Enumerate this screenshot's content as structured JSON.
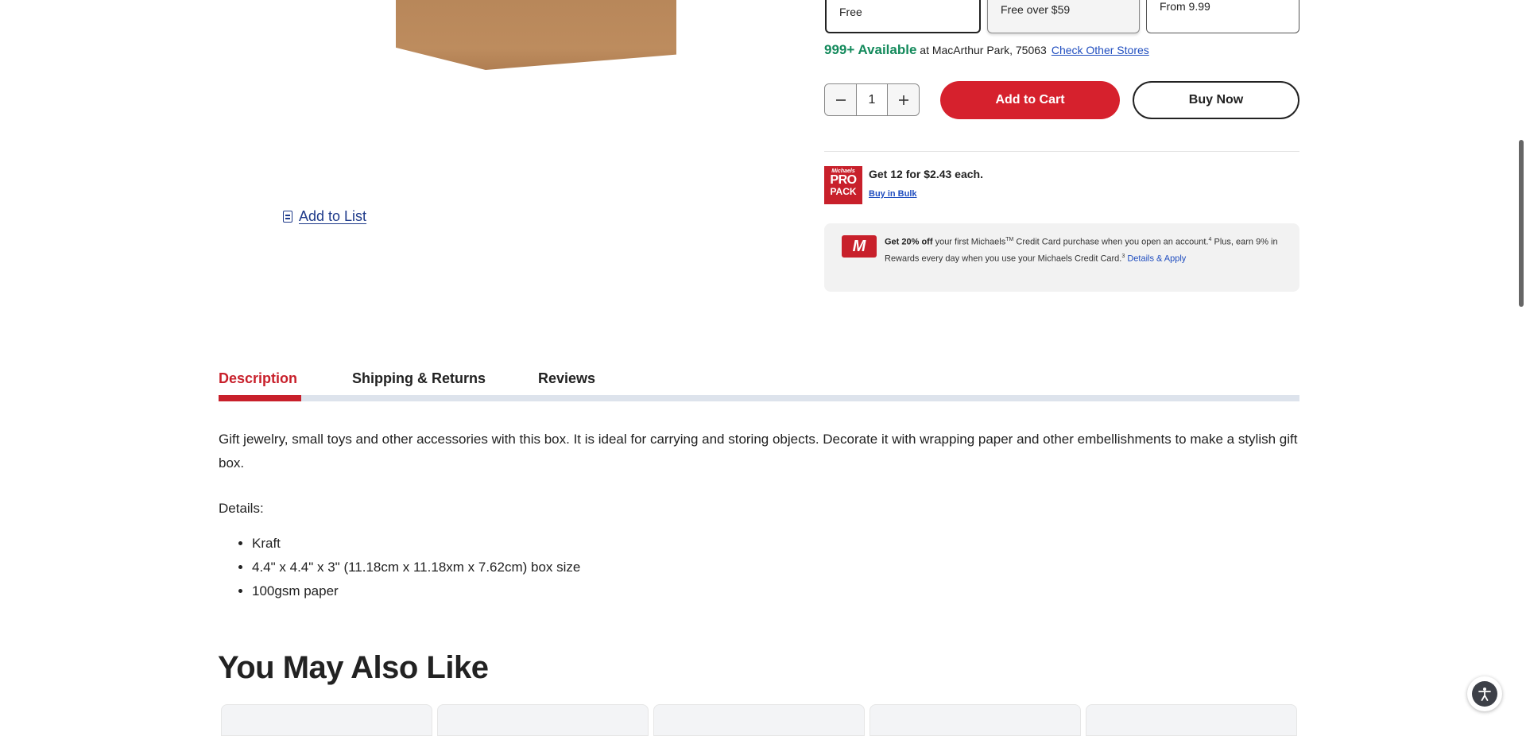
{
  "gallery": {
    "add_to_list_label": "Add to List"
  },
  "shipping": {
    "options": [
      {
        "label": "Free"
      },
      {
        "label": "Free over $59"
      },
      {
        "label": "From 9.99"
      }
    ]
  },
  "availability": {
    "count": "999+ Available",
    "location": " at MacArthur Park, 75063",
    "check_link": "Check Other Stores"
  },
  "purchase": {
    "quantity": "1",
    "add_to_cart": "Add to Cart",
    "buy_now": "Buy Now"
  },
  "propack": {
    "logo_small": "Michaels",
    "logo_big": "PRO",
    "logo_pack": "PACK",
    "title": "Get 12 for $2.43 each.",
    "link": "Buy in Bulk"
  },
  "credit_promo": {
    "card_letter": "M",
    "bold": "Get 20% off",
    "text1": " your first Michaels",
    "tm": "TM",
    "text2": " Credit Card purchase when you open an account.",
    "sup1": "4",
    "text3": " Plus, earn 9% in Rewards every day when you use your Michaels Credit Card.",
    "sup2": "3",
    "link": "Details & Apply"
  },
  "tabs": [
    {
      "label": "Description"
    },
    {
      "label": "Shipping & Returns"
    },
    {
      "label": "Reviews"
    }
  ],
  "description": {
    "text": "Gift jewelry, small toys and other accessories with this box. It is ideal for carrying and storing objects. Decorate it with wrapping paper and other embellishments to make a stylish gift box.",
    "details_label": "Details:",
    "details": [
      "Kraft",
      "4.4\" x 4.4\" x 3\" (11.18cm x 11.18xm x 7.62cm) box size",
      "100gsm paper"
    ]
  },
  "recommendations": {
    "title": "You May Also Like"
  },
  "colors": {
    "brand_red": "#d6212d",
    "link_blue": "#1f4dbf",
    "available_green": "#148a5c"
  },
  "icons": [
    "list-icon",
    "minus-icon",
    "plus-icon",
    "michaels-card-icon",
    "accessibility-icon"
  ]
}
